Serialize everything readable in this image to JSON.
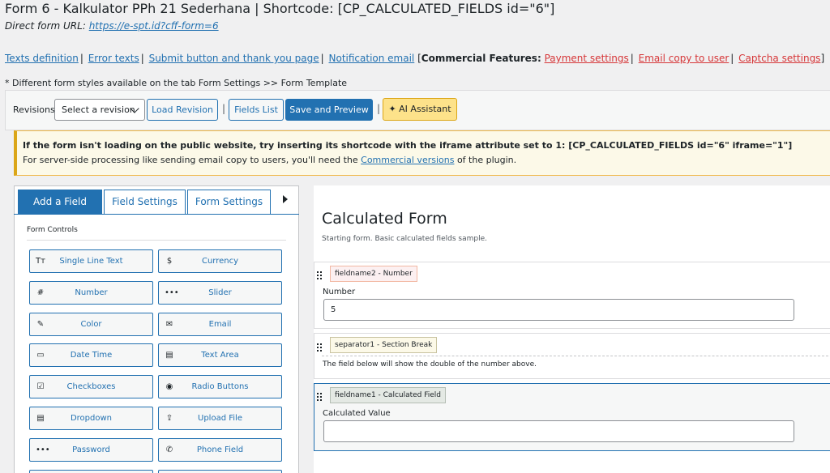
{
  "header": {
    "title": "Form 6 - Kalkulator PPh 21 Sederhana | Shortcode: [CP_CALCULATED_FIELDS id=\"6\"]",
    "direct_label": "Direct form URL:",
    "direct_url": "https://e-spt.id?cff-form=6"
  },
  "links": {
    "texts_definition": "Texts definition",
    "error_texts": "Error texts",
    "submit_button": "Submit button and thank you page",
    "notification_email": "Notification email",
    "commercial_label": "Commercial Features:",
    "payment_settings": "Payment settings",
    "email_copy": "Email copy to user",
    "captcha_settings": "Captcha settings",
    "sep": "|",
    "open_bracket": "[",
    "close_bracket": "]"
  },
  "note": "* Different form styles available on the tab Form Settings >> Form Template",
  "toolbar": {
    "revisions_label": "Revisions",
    "revision_select": "Select a revision",
    "load_revision": "Load Revision",
    "fields_list": "Fields List",
    "save_preview": "Save and Preview",
    "ai_assistant": "AI Assistant",
    "sep": "|"
  },
  "notice": {
    "line1": "If the form isn't loading on the public website, try inserting its shortcode with the iframe attribute set to 1: [CP_CALCULATED_FIELDS id=\"6\" iframe=\"1\"]",
    "line2_prefix": "For server-side processing like sending email copy to users, you'll need the",
    "line2_link": "Commercial versions",
    "line2_suffix": "of the plugin."
  },
  "tabs": {
    "add_field": "Add a Field",
    "field_settings": "Field Settings",
    "form_settings": "Form Settings"
  },
  "form_controls": {
    "heading": "Form Controls",
    "items": [
      {
        "label": "Single Line Text",
        "icon": "text-icon",
        "glyph": "Tт"
      },
      {
        "label": "Currency",
        "icon": "dollar-icon",
        "glyph": "$"
      },
      {
        "label": "Number",
        "icon": "hash-icon",
        "glyph": "#"
      },
      {
        "label": "Slider",
        "icon": "dots-icon",
        "glyph": "•••"
      },
      {
        "label": "Color",
        "icon": "pencil-icon",
        "glyph": "✎"
      },
      {
        "label": "Email",
        "icon": "envelope-icon",
        "glyph": "✉"
      },
      {
        "label": "Date Time",
        "icon": "calendar-icon",
        "glyph": "▭"
      },
      {
        "label": "Text Area",
        "icon": "textarea-icon",
        "glyph": "▤"
      },
      {
        "label": "Checkboxes",
        "icon": "checkbox-icon",
        "glyph": "☑"
      },
      {
        "label": "Radio Buttons",
        "icon": "radio-icon",
        "glyph": "◉"
      },
      {
        "label": "Dropdown",
        "icon": "dropdown-icon",
        "glyph": "▤"
      },
      {
        "label": "Upload File",
        "icon": "upload-icon",
        "glyph": "⇪"
      },
      {
        "label": "Password",
        "icon": "password-icon",
        "glyph": "•••"
      },
      {
        "label": "Phone Field",
        "icon": "phone-icon",
        "glyph": "✆"
      }
    ]
  },
  "form": {
    "title": "Calculated Form",
    "description": "Starting form. Basic calculated fields sample.",
    "fields": [
      {
        "tag": "fieldname2 - Number",
        "label": "Number",
        "value": "5"
      },
      {
        "tag": "separator1 - Section Break",
        "text": "The field below will show the double of the number above."
      },
      {
        "tag": "fieldname1 - Calculated Field",
        "label": "Calculated Value",
        "value": ""
      }
    ]
  }
}
